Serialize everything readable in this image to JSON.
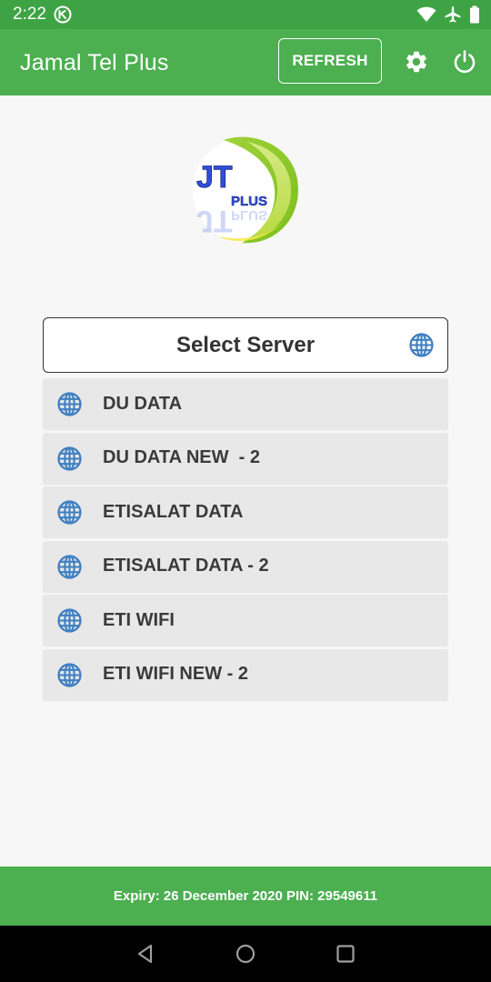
{
  "status_bar": {
    "time": "2:22",
    "icons": [
      "data-saver-icon",
      "wifi-icon",
      "airplane-icon",
      "battery-icon"
    ]
  },
  "app_bar": {
    "title": "Jamal Tel Plus",
    "refresh_label": "REFRESH",
    "icons": [
      "gear-icon",
      "power-icon"
    ]
  },
  "logo": {
    "text_primary": "JT",
    "text_secondary": "PLUS"
  },
  "server_select": {
    "label": "Select Server",
    "icon": "globe-icon"
  },
  "servers": [
    {
      "label": "DU DATA",
      "icon": "globe-icon"
    },
    {
      "label": "DU DATA NEW  - 2",
      "icon": "globe-icon"
    },
    {
      "label": "ETISALAT DATA",
      "icon": "globe-icon"
    },
    {
      "label": "ETISALAT DATA - 2",
      "icon": "globe-icon"
    },
    {
      "label": "ETI WIFI",
      "icon": "globe-icon"
    },
    {
      "label": "ETI WIFI NEW - 2",
      "icon": "globe-icon"
    }
  ],
  "footer": {
    "text": "Expiry: 26 December 2020 PIN: 29549611"
  },
  "colors": {
    "status_bar": "#3ea344",
    "primary": "#4caf50",
    "icon_blue": "#3f7fc1",
    "item_bg": "#e8e8e8",
    "text_dark": "#3a3a3a"
  }
}
